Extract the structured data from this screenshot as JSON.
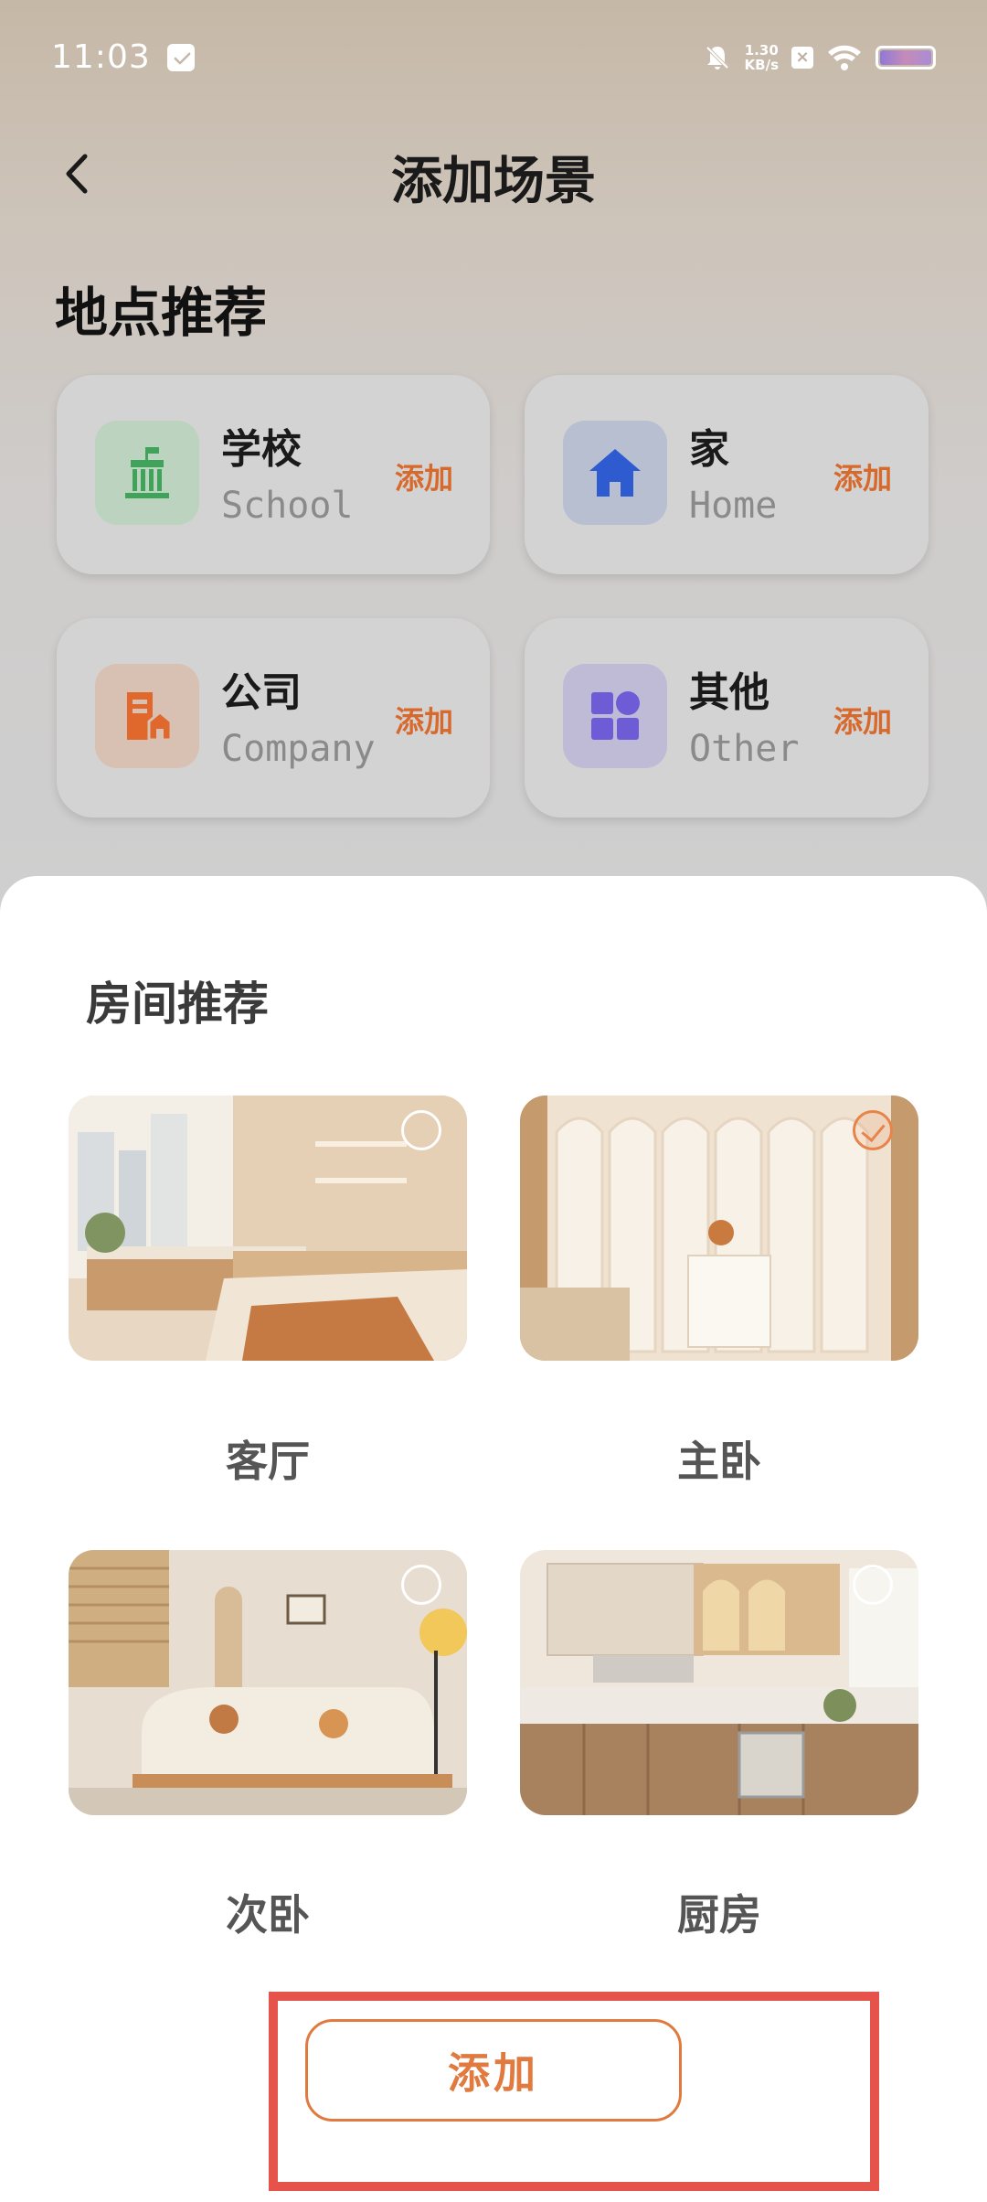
{
  "status_bar": {
    "time": "11:03",
    "net_speed_value": "1.30",
    "net_speed_unit": "KB/s",
    "icons": [
      "message-icon",
      "mute-bell-icon",
      "x-icon",
      "wifi-icon",
      "battery-icon"
    ]
  },
  "header": {
    "title": "添加场景",
    "back_icon": "chevron-left-icon"
  },
  "location_section": {
    "title": "地点推荐",
    "items": [
      {
        "name": "学校",
        "en": "School",
        "add_label": "添加",
        "icon": "school-icon",
        "icon_color": "#3fa35a",
        "icon_bg": "#bcd3bf"
      },
      {
        "name": "家",
        "en": "Home",
        "add_label": "添加",
        "icon": "home-icon",
        "icon_color": "#2f5bd1",
        "icon_bg": "#b7bfd1"
      },
      {
        "name": "公司",
        "en": "Company",
        "add_label": "添加",
        "icon": "company-icon",
        "icon_color": "#e0682c",
        "icon_bg": "#d8c0b2"
      },
      {
        "name": "其他",
        "en": "Other",
        "add_label": "添加",
        "icon": "other-grid-icon",
        "icon_color": "#6e5bd6",
        "icon_bg": "#bfbbd6"
      }
    ]
  },
  "room_section": {
    "title": "房间推荐",
    "rooms": [
      {
        "label": "客厅",
        "selected": false
      },
      {
        "label": "主卧",
        "selected": true
      },
      {
        "label": "次卧",
        "selected": false
      },
      {
        "label": "厨房",
        "selected": false
      }
    ]
  },
  "footer": {
    "add_button_label": "添加"
  },
  "colors": {
    "accent": "#e07a3f",
    "highlight_frame": "#e5534b"
  }
}
